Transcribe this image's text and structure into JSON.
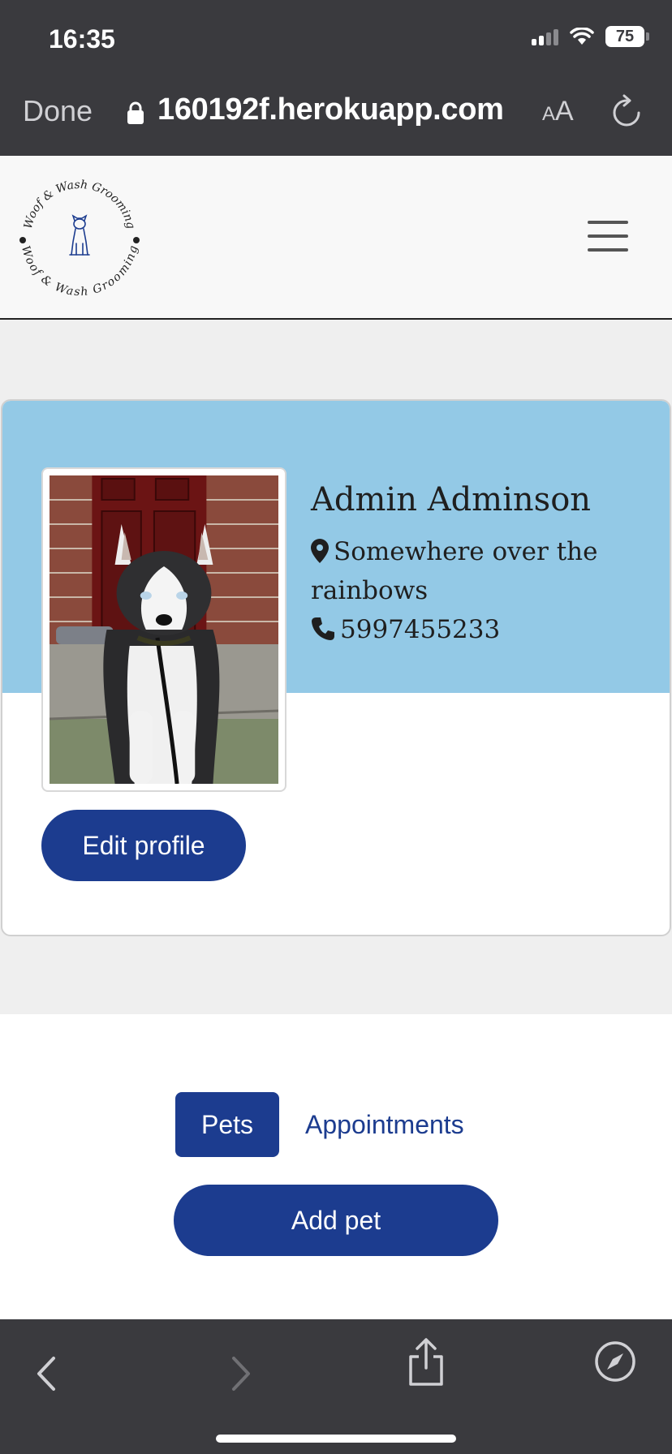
{
  "status_bar": {
    "time": "16:35",
    "battery": "75"
  },
  "url_bar": {
    "done_label": "Done",
    "url": "160192f.herokuapp.com",
    "text_size_label_small": "A",
    "text_size_label_large": "A"
  },
  "navbar": {
    "logo_text": "Woof & Wash Grooming"
  },
  "profile": {
    "name": "Admin Adminson",
    "location": "Somewhere over the rainbows",
    "phone": "5997455233",
    "edit_label": "Edit profile"
  },
  "tabs": {
    "items": [
      {
        "label": "Pets",
        "active": true
      },
      {
        "label": "Appointments",
        "active": false
      }
    ],
    "add_pet_label": "Add pet"
  },
  "colors": {
    "primary": "#1c3c8f",
    "header_blue": "#93c9e6",
    "system_bar": "#3a3a3e"
  }
}
